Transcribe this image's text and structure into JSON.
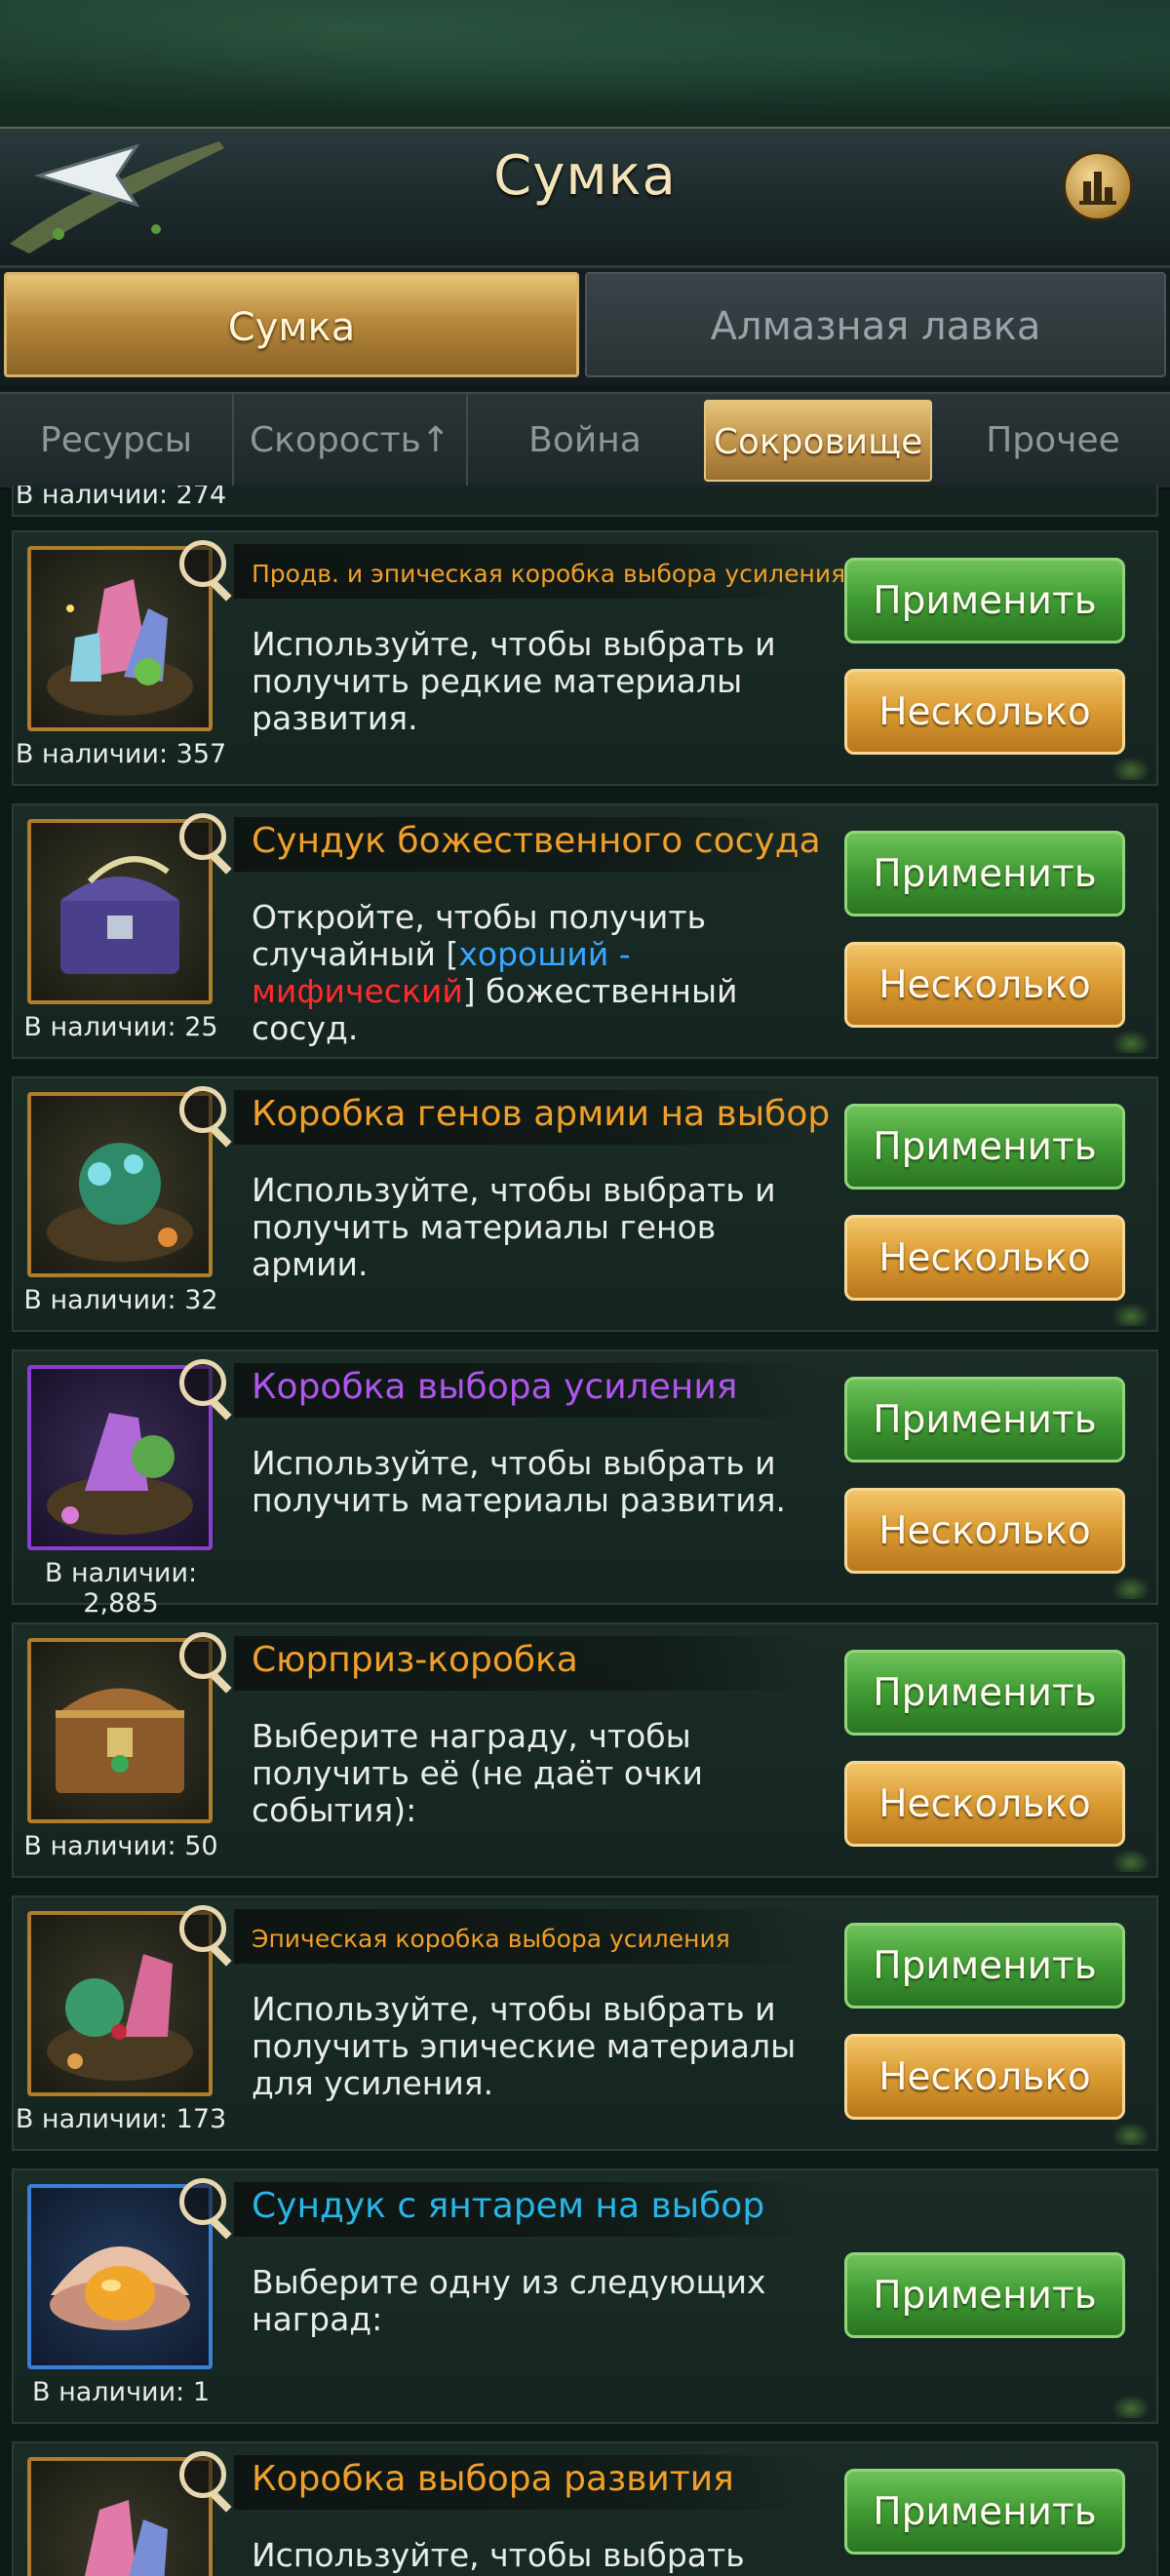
{
  "header": {
    "title": "Сумка"
  },
  "main_tabs": [
    {
      "label": "Сумка",
      "active": true
    },
    {
      "label": "Алмазная лавка",
      "active": false
    }
  ],
  "sub_tabs": [
    {
      "label": "Ресурсы"
    },
    {
      "label": "Скорость↑"
    },
    {
      "label": "Война"
    },
    {
      "label": "Сокровище",
      "active": true
    },
    {
      "label": "Прочее"
    }
  ],
  "items": [
    {
      "name": "Продв. и эпическая коробка выбора усиления",
      "desc": "Используйте, чтобы выбрать и получить редкие материалы развития.",
      "qty": "В наличии: 357",
      "apply": "Применить",
      "multi": "Несколько",
      "icon": "crystal-nest-icon"
    },
    {
      "name": "Сундук божественного сосуда",
      "desc_parts": [
        "Откройте, чтобы получить случайный [",
        "хороший -",
        " ",
        "мифический",
        "] божественный сосуд."
      ],
      "qty": "В наличии: 25",
      "apply": "Применить",
      "multi": "Несколько",
      "icon": "purple-chest-icon"
    },
    {
      "name": "Коробка генов армии на выбор",
      "desc": "Используйте, чтобы выбрать и получить материалы генов армии.",
      "qty": "В наличии: 32",
      "apply": "Применить",
      "multi": "Несколько",
      "icon": "gene-nest-icon"
    },
    {
      "name": "Коробка выбора усиления",
      "desc": "Используйте, чтобы выбрать и получить материалы развития.",
      "qty": "В наличии: 2,885",
      "apply": "Применить",
      "multi": "Несколько",
      "icon": "enhancement-nest-icon"
    },
    {
      "name": "Сюрприз-коробка",
      "desc": "Выберите награду, чтобы получить её (не даёт очки события):",
      "qty": "В наличии: 50",
      "apply": "Применить",
      "multi": "Несколько",
      "icon": "treasure-chest-icon"
    },
    {
      "name": "Эпическая коробка выбора усиления",
      "desc": "Используйте, чтобы выбрать и получить эпические материалы для усиления.",
      "qty": "В наличии: 173",
      "apply": "Применить",
      "multi": "Несколько",
      "icon": "epic-nest-icon"
    },
    {
      "name": "Сундук с янтарем на выбор",
      "desc": "Выберите одну из следующих наград:",
      "qty": "В наличии: 1",
      "apply": "Применить",
      "icon": "amber-shell-icon"
    },
    {
      "name": "Коробка выбора развития",
      "desc": "Используйте, чтобы выбрать",
      "apply": "Применить",
      "icon": "crystal-nest-icon"
    }
  ],
  "partial_top_qty": "В наличии: 274"
}
